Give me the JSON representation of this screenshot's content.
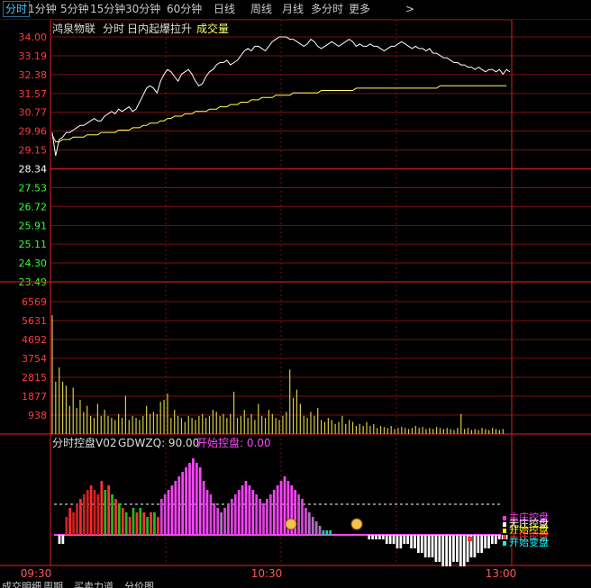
{
  "tabs": [
    "分时",
    "1分钟",
    "5分钟",
    "15分钟",
    "30分钟",
    "60分钟",
    "日线",
    "周线",
    "月线",
    "多分时",
    "更多"
  ],
  "active_tab": "分时",
  "more_icon": "chevron-right-icon",
  "header": {
    "stock_name": "鸿泉物联",
    "mode": "分时",
    "indicator_name": "日内起爆拉升",
    "volume_label": "成交量"
  },
  "price_axis": {
    "labels": [
      "34.00",
      "33.19",
      "32.38",
      "31.57",
      "30.77",
      "29.96",
      "29.15",
      "28.34",
      "27.53",
      "26.72",
      "25.91",
      "25.11",
      "24.30",
      "23.49"
    ],
    "prev_close": "28.34",
    "colors": {
      "up": "#ff3b3b",
      "flat": "#ffffff",
      "down": "#33ff33"
    }
  },
  "volume_axis": {
    "labels": [
      "6569",
      "5631",
      "4692",
      "3754",
      "2815",
      "1877",
      "938"
    ]
  },
  "time_axis": {
    "labels": [
      "09:30",
      "10:30",
      "13:00"
    ]
  },
  "sub_indicator": {
    "title": "分时控盘V02",
    "param_label": "GDWZQ: 90.00",
    "signal_label": "开始控盘: 0.00",
    "legend": [
      "主庄控盘",
      "无庄控盘",
      "开始控盘",
      "主庄控盘",
      "开始变盘"
    ],
    "legend_colors": [
      "#ff33ff",
      "#ffffff",
      "#ffff00",
      "#ff3333",
      "#00ffff"
    ]
  },
  "bottom_tabs": [
    "成交明细",
    "周期",
    "买卖力道",
    "分价图"
  ],
  "chart_data": {
    "type": "line",
    "price_line": [
      29.9,
      28.9,
      29.6,
      29.7,
      29.9,
      29.9,
      30.0,
      30.1,
      30.2,
      30.2,
      30.3,
      30.4,
      30.5,
      30.4,
      30.4,
      30.6,
      30.7,
      30.8,
      30.7,
      30.9,
      30.8,
      30.9,
      31.0,
      30.8,
      30.9,
      31.2,
      31.5,
      31.8,
      31.9,
      31.8,
      31.6,
      32.1,
      32.4,
      32.6,
      32.5,
      32.3,
      32.1,
      32.4,
      32.5,
      32.6,
      32.4,
      32.1,
      31.9,
      32.0,
      32.3,
      32.5,
      32.6,
      32.8,
      32.9,
      32.9,
      33.0,
      32.8,
      32.9,
      33.0,
      33.2,
      33.4,
      33.5,
      33.4,
      33.6,
      33.6,
      33.5,
      33.4,
      33.6,
      33.8,
      33.9,
      34.0,
      34.0,
      34.0,
      33.9,
      33.9,
      33.8,
      33.7,
      33.6,
      33.7,
      33.9,
      33.8,
      33.6,
      33.5,
      33.6,
      33.7,
      33.8,
      33.7,
      33.6,
      33.7,
      33.8,
      33.9,
      33.8,
      33.6,
      33.7,
      33.6,
      33.6,
      33.7,
      33.6,
      33.6,
      33.5,
      33.4,
      33.5,
      33.6,
      33.6,
      33.7,
      33.8,
      33.7,
      33.6,
      33.5,
      33.6,
      33.5,
      33.5,
      33.4,
      33.5,
      33.3,
      33.3,
      33.2,
      33.1,
      33.1,
      33.0,
      32.9,
      32.9,
      32.8,
      32.8,
      32.7,
      32.7,
      32.6,
      32.7,
      32.6,
      32.5,
      32.6,
      32.6,
      32.5,
      32.6,
      32.4,
      32.6,
      32.5
    ],
    "avg_line": [
      29.8,
      29.5,
      29.5,
      29.6,
      29.6,
      29.6,
      29.7,
      29.7,
      29.7,
      29.7,
      29.8,
      29.8,
      29.8,
      29.8,
      29.9,
      29.9,
      29.9,
      29.9,
      29.9,
      30.0,
      30.0,
      30.0,
      30.0,
      30.1,
      30.1,
      30.1,
      30.2,
      30.2,
      30.3,
      30.3,
      30.3,
      30.4,
      30.4,
      30.5,
      30.5,
      30.6,
      30.6,
      30.6,
      30.7,
      30.7,
      30.7,
      30.8,
      30.8,
      30.8,
      30.8,
      30.9,
      30.9,
      30.9,
      31.0,
      31.0,
      31.0,
      31.1,
      31.1,
      31.1,
      31.2,
      31.2,
      31.2,
      31.3,
      31.3,
      31.3,
      31.4,
      31.4,
      31.4,
      31.4,
      31.5,
      31.5,
      31.5,
      31.5,
      31.5,
      31.6,
      31.6,
      31.6,
      31.6,
      31.6,
      31.6,
      31.6,
      31.6,
      31.7,
      31.7,
      31.7,
      31.7,
      31.7,
      31.7,
      31.7,
      31.7,
      31.7,
      31.7,
      31.8,
      31.8,
      31.8,
      31.8,
      31.8,
      31.8,
      31.8,
      31.8,
      31.8,
      31.8,
      31.8,
      31.8,
      31.8,
      31.8,
      31.8,
      31.8,
      31.8,
      31.8,
      31.8,
      31.8,
      31.8,
      31.8,
      31.8,
      31.8,
      31.9,
      31.9,
      31.9,
      31.9,
      31.9,
      31.9,
      31.9,
      31.9,
      31.9,
      31.9,
      31.9,
      31.9,
      31.9,
      31.9,
      31.9,
      31.9,
      31.9,
      31.9,
      31.9,
      31.9
    ],
    "volume": [
      5900,
      2600,
      3300,
      2600,
      2400,
      1400,
      2300,
      1300,
      1700,
      1100,
      1400,
      900,
      800,
      1500,
      900,
      1200,
      900,
      800,
      700,
      1000,
      800,
      1900,
      700,
      900,
      800,
      700,
      900,
      1400,
      1000,
      1100,
      1000,
      1600,
      1700,
      2000,
      800,
      1200,
      900,
      800,
      600,
      900,
      800,
      700,
      900,
      1000,
      800,
      900,
      1200,
      1100,
      900,
      1000,
      800,
      1000,
      2100,
      800,
      900,
      1200,
      800,
      1000,
      700,
      1500,
      900,
      800,
      1200,
      1000,
      800,
      700,
      900,
      1100,
      3200,
      1800,
      2200,
      1500,
      900,
      800,
      1100,
      900,
      1300,
      700,
      600,
      800,
      700,
      500,
      600,
      900,
      500,
      700,
      600,
      400,
      500,
      400,
      600,
      400,
      500,
      300,
      400,
      350,
      300,
      400,
      250,
      300,
      350,
      300,
      250,
      300,
      400,
      300,
      350,
      250,
      300,
      250,
      350,
      300,
      250,
      300,
      250,
      200,
      300,
      1000,
      250,
      300,
      200,
      250,
      200,
      300,
      250,
      200,
      300,
      250,
      200,
      250
    ],
    "control_bars": [
      -2,
      -2,
      4,
      6,
      5,
      7,
      8,
      9,
      10,
      11,
      10,
      9,
      12,
      10,
      11,
      9,
      8,
      7,
      6,
      5,
      4,
      6,
      5,
      6,
      5,
      4,
      5,
      5,
      4,
      8,
      9,
      10,
      11,
      12,
      13,
      14,
      15,
      16,
      17,
      16,
      15,
      12,
      10,
      9,
      7,
      6,
      5,
      6,
      7,
      8,
      9,
      10,
      11,
      12,
      11,
      10,
      9,
      8,
      7,
      8,
      9,
      10,
      11,
      12,
      13,
      12,
      11,
      10,
      9,
      8,
      6,
      5,
      4,
      3,
      2,
      1,
      1,
      1,
      0,
      0,
      0,
      0,
      0,
      0,
      0,
      0,
      0,
      0,
      -1,
      -1,
      -1,
      -1,
      -1,
      -2,
      -2,
      -2,
      -3,
      -3,
      -2,
      -2,
      -3,
      -3,
      -4,
      -4,
      -5,
      -5,
      -5,
      -6,
      -6,
      -7,
      -7,
      -7,
      -6,
      -6,
      -7,
      -7,
      -6,
      -5,
      -5,
      -4,
      -4,
      -3,
      -3,
      -2,
      -2,
      -1,
      -1,
      -1
    ],
    "price_range": [
      23.49,
      34.0
    ],
    "volume_range": [
      0,
      6569
    ],
    "prev_close": 28.34
  }
}
